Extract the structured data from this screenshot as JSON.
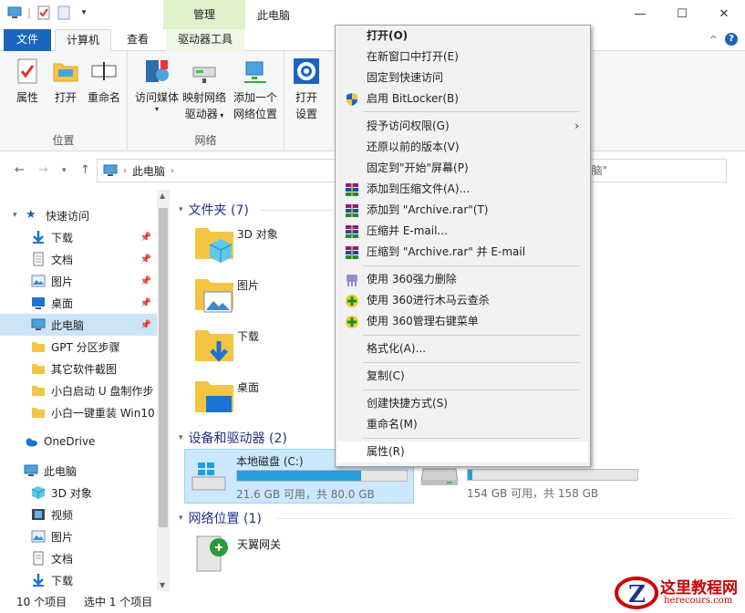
{
  "window": {
    "title": "此电脑",
    "context_tab_group": "管理",
    "minimize": "—",
    "maximize": "☐",
    "close": "✕"
  },
  "ribbon_tabs": {
    "file": "文件",
    "computer": "计算机",
    "view": "查看",
    "drive_tools": "驱动器工具"
  },
  "ribbon": {
    "location_group": "位置",
    "network_group": "网络",
    "properties": "属性",
    "open": "打开",
    "rename": "重命名",
    "access_media": "访问媒体",
    "map_drive_1": "映射网络",
    "map_drive_2": "驱动器",
    "add_location_1": "添加一个",
    "add_location_2": "网络位置",
    "open_settings_1": "打开",
    "open_settings_2": "设置"
  },
  "address": {
    "path": "此电脑",
    "search_placeholder": "索\"此电脑\""
  },
  "nav": {
    "quick_access": "快速访问",
    "downloads": "下载",
    "documents": "文档",
    "pictures": "图片",
    "desktop": "桌面",
    "this_pc": "此电脑",
    "f1": "GPT 分区步骤",
    "f2": "其它软件截图",
    "f3": "小白启动 U 盘制作步",
    "f4": "小白一键重装 Win10",
    "onedrive": "OneDrive",
    "this_pc2": "此电脑",
    "objects3d": "3D 对象",
    "videos": "视频",
    "pictures2": "图片",
    "documents2": "文档",
    "downloads2": "下载"
  },
  "content": {
    "folders_header": "文件夹 (7)",
    "folders": [
      "3D 对象",
      "图片",
      "下载",
      "桌面"
    ],
    "devices_header": "设备和驱动器 (2)",
    "drive_c": {
      "name": "本地磁盘 (C:)",
      "info": "21.6 GB 可用，共 80.0 GB",
      "used_fraction": 0.73
    },
    "drive_d": {
      "name": "",
      "info": "154 GB 可用，共 158 GB",
      "used_fraction": 0.025
    },
    "network_header": "网络位置 (1)",
    "network_item": "天翼网关"
  },
  "status": {
    "items": "10 个项目",
    "selected": "选中 1 个项目"
  },
  "context_menu": {
    "open": "打开(O)",
    "open_new_window": "在新窗口中打开(E)",
    "pin_quick_access": "固定到快速访问",
    "bitlocker": "启用 BitLocker(B)",
    "grant_access": "授予访问权限(G)",
    "restore_versions": "还原以前的版本(V)",
    "pin_start": "固定到\"开始\"屏幕(P)",
    "add_archive": "添加到压缩文件(A)...",
    "add_archive_rar": "添加到 \"Archive.rar\"(T)",
    "compress_email": "压缩并 E-mail...",
    "compress_rar_email": "压缩到 \"Archive.rar\" 并 E-mail",
    "force_delete_360": "使用 360强力删除",
    "trojan_scan_360": "使用 360进行木马云查杀",
    "manage_menu_360": "使用 360管理右键菜单",
    "format": "格式化(A)...",
    "copy": "复制(C)",
    "create_shortcut": "创建快捷方式(S)",
    "rename": "重命名(M)",
    "properties": "属性(R)"
  },
  "watermark": {
    "title": "这里教程网",
    "url": "herecours.com"
  },
  "colors": {
    "accent": "#1a65c0",
    "selection": "#cce8ff",
    "progress": "#26a0da",
    "context_tab": "#dff2cc"
  }
}
